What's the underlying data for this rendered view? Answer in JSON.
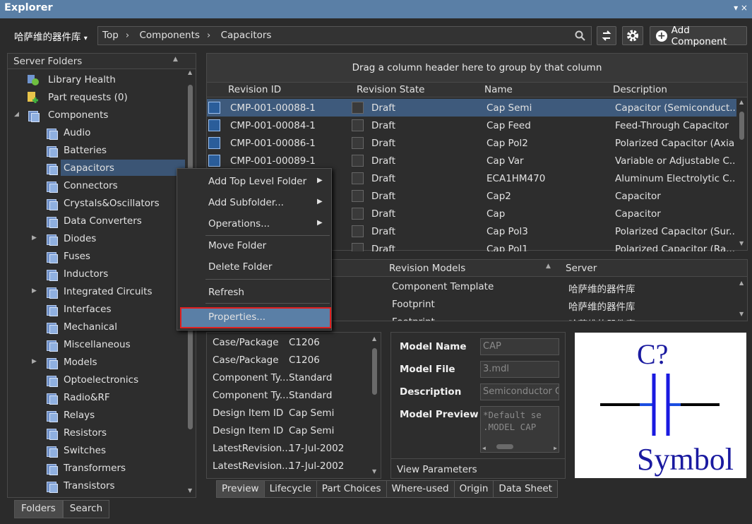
{
  "window": {
    "title": "Explorer",
    "controls": "▾  ×"
  },
  "toolbar": {
    "library": "哈萨维的器件库",
    "library_arrow": "▾",
    "breadcrumb": [
      "Top",
      "Components",
      "Capacitors"
    ],
    "add_component": "Add Component"
  },
  "left": {
    "header": "Server Folders",
    "top_items": [
      {
        "label": "Library Health"
      },
      {
        "label": "Part requests (0)"
      },
      {
        "label": "Components"
      }
    ],
    "folders": [
      {
        "label": "Audio"
      },
      {
        "label": "Batteries"
      },
      {
        "label": "Capacitors"
      },
      {
        "label": "Connectors"
      },
      {
        "label": "Crystals&Oscillators"
      },
      {
        "label": "Data Converters"
      },
      {
        "label": "Diodes"
      },
      {
        "label": "Fuses"
      },
      {
        "label": "Inductors"
      },
      {
        "label": "Integrated Circuits"
      },
      {
        "label": "Interfaces"
      },
      {
        "label": "Mechanical"
      },
      {
        "label": "Miscellaneous"
      },
      {
        "label": "Models"
      },
      {
        "label": "Optoelectronics"
      },
      {
        "label": "Radio&RF"
      },
      {
        "label": "Relays"
      },
      {
        "label": "Resistors"
      },
      {
        "label": "Switches"
      },
      {
        "label": "Transformers"
      },
      {
        "label": "Transistors"
      }
    ],
    "tabs": [
      "Folders",
      "Search"
    ]
  },
  "grid": {
    "group_hint": "Drag a column header here to group by that column",
    "columns": [
      "Revision ID",
      "Revision State",
      "Name",
      "Description"
    ],
    "rows": [
      {
        "id": "CMP-001-00088-1",
        "state": "Draft",
        "name": "Cap Semi",
        "desc": "Capacitor (Semiconduct..."
      },
      {
        "id": "CMP-001-00084-1",
        "state": "Draft",
        "name": "Cap Feed",
        "desc": "Feed-Through Capacitor"
      },
      {
        "id": "CMP-001-00086-1",
        "state": "Draft",
        "name": "Cap Pol2",
        "desc": "Polarized Capacitor (Axial)"
      },
      {
        "id": "CMP-001-00089-1",
        "state": "Draft",
        "name": "Cap Var",
        "desc": "Variable or Adjustable C..."
      },
      {
        "id": "",
        "state": "Draft",
        "name": "ECA1HM470",
        "desc": "Aluminum Electrolytic C..."
      },
      {
        "id": "",
        "state": "Draft",
        "name": "Cap2",
        "desc": "Capacitor"
      },
      {
        "id": "",
        "state": "Draft",
        "name": "Cap",
        "desc": "Capacitor"
      },
      {
        "id": "",
        "state": "Draft",
        "name": "Cap Pol3",
        "desc": "Polarized Capacitor (Sur..."
      },
      {
        "id": "",
        "state": "Draft",
        "name": "Cap Pol1",
        "desc": "Polarized Capacitor (Ra..."
      }
    ]
  },
  "models": {
    "columns": [
      "Revision Models",
      "Server"
    ],
    "rows": [
      {
        "model": "Component Template",
        "server": "哈萨维的器件库"
      },
      {
        "model": "Footprint",
        "server": "哈萨维的器件库"
      },
      {
        "model": "Footprint",
        "server": "哈萨维的器件库"
      }
    ]
  },
  "params": [
    {
      "k": "Case/Package",
      "v": "C1206"
    },
    {
      "k": "Case/Package",
      "v": "C1206"
    },
    {
      "k": "Component Ty...",
      "v": "Standard"
    },
    {
      "k": "Component Ty...",
      "v": "Standard"
    },
    {
      "k": "Design Item ID",
      "v": "Cap Semi"
    },
    {
      "k": "Design Item ID",
      "v": "Cap Semi"
    },
    {
      "k": "LatestRevision...",
      "v": "17-Jul-2002"
    },
    {
      "k": "LatestRevision...",
      "v": "17-Jul-2002"
    }
  ],
  "detail": {
    "model_name_label": "Model Name",
    "model_name": "CAP",
    "model_file_label": "Model File",
    "model_file": "3.mdl",
    "description_label": "Description",
    "description": "Semiconductor Ca",
    "preview_label": "Model Preview",
    "preview_line1": "*Default se",
    "preview_line2": ".MODEL CAP",
    "view_params": "View Parameters"
  },
  "symbol": {
    "designator": "C?",
    "text": "Symbol"
  },
  "right_tabs": [
    "Preview",
    "Lifecycle",
    "Part Choices",
    "Where-used",
    "Origin",
    "Data Sheet"
  ],
  "context_menu": {
    "items": [
      "Add Top Level Folder",
      "Add Subfolder...",
      "Operations...",
      "Move Folder",
      "Delete Folder",
      "Refresh",
      "Properties..."
    ]
  }
}
